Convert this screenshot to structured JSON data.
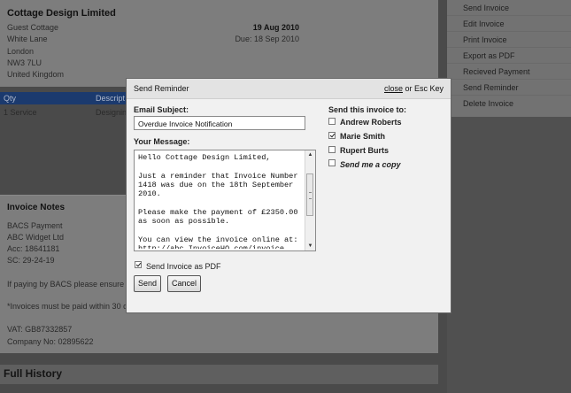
{
  "invoice": {
    "company": "Cottage Design Limited",
    "address": [
      "Guest Cottage",
      "White Lane",
      "London",
      "NW3 7LU",
      "United Kingdom"
    ],
    "issue_date": "19 Aug 2010",
    "due_date": "Due: 18 Sep 2010"
  },
  "table": {
    "headers": [
      "Qty",
      "Descript"
    ],
    "row": [
      "1 Service",
      "Designin"
    ]
  },
  "notes": {
    "title": "Invoice Notes",
    "lines": [
      "BACS Payment",
      "ABC Widget Ltd",
      "Acc: 18641181",
      "SC: 29-24-19",
      "If paying by BACS please ensure yo",
      "*Invoices must be paid within 30 da",
      "VAT: GB87332857",
      "Company No: 02895622"
    ]
  },
  "history": {
    "title": "Full History"
  },
  "sidebar": {
    "items": [
      "Send Invoice",
      "Edit Invoice",
      "Print Invoice",
      "Export as PDF",
      "Recieved Payment",
      "Send Reminder",
      "Delete Invoice"
    ]
  },
  "modal": {
    "title": "Send Reminder",
    "close_link": "close",
    "close_hint": " or Esc Key",
    "subject_label": "Email Subject:",
    "subject_value": "Overdue Invoice Notification",
    "message_label": "Your Message:",
    "message_text": "Hello Cottage Design Limited,\n\nJust a reminder that Invoice Number 1418 was due on the 18th September 2010.\n\nPlease make the payment of £2350.00 as soon as possible.\n\nYou can view the invoice online at:\nhttp://abc.InvoiceHQ.com/invoice",
    "send_pdf_label": "Send Invoice as PDF",
    "send_pdf_checked": true,
    "send_button": "Send",
    "cancel_button": "Cancel",
    "recipients_label": "Send this invoice to:",
    "recipients": [
      {
        "name": "Andrew Roberts",
        "checked": false
      },
      {
        "name": "Marie Smith",
        "checked": true
      },
      {
        "name": "Rupert Burts",
        "checked": false
      },
      {
        "name": "Send me a copy",
        "checked": false
      }
    ]
  }
}
